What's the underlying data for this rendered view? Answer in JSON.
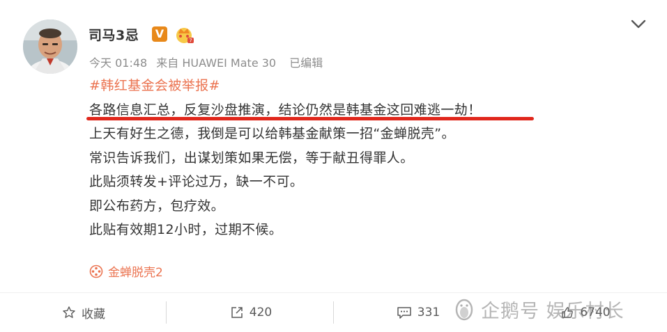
{
  "post": {
    "author": "司马3忌",
    "verified_badge": "V",
    "time": "今天 01:48",
    "source": "来自 HUAWEI Mate 30",
    "edited": "已编辑",
    "topic": "#韩红基金会被举报#",
    "lines": [
      "各路信息汇总，反复沙盘推演，结论仍然是韩基金这回难逃一劫！",
      "上天有好生之德，我倒是可以给韩基金献策一招“金蝉脱壳”。",
      "常识告诉我们，出谋划策如果无偿，等于献丑得罪人。",
      "此贴须转发+评论过万，缺一不可。",
      "即公布药方，包疗效。",
      "此贴有效期12小时，过期不候。"
    ],
    "link_label": "金蝉脱壳2"
  },
  "actions": {
    "favorite": "收藏",
    "repost_count": "420",
    "comment_count": "331",
    "like_count": "6740"
  },
  "watermark": "企鹅号 娱乐村长",
  "colors": {
    "topic": "#eb7350",
    "underline": "#e0271c",
    "badge": "#e8891a"
  }
}
